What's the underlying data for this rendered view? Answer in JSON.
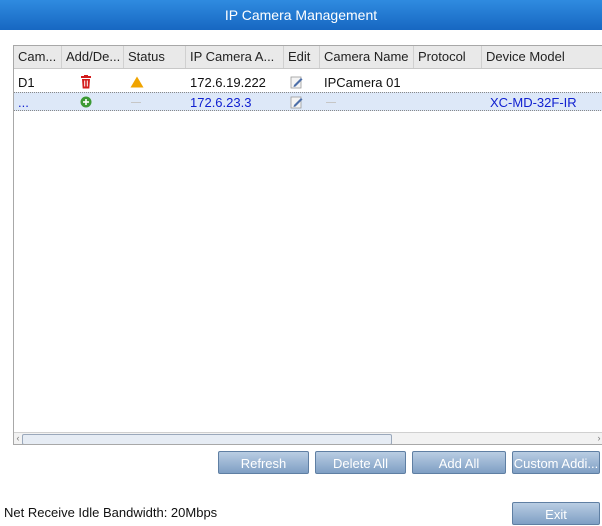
{
  "window": {
    "title": "IP Camera Management"
  },
  "table": {
    "headers": [
      "Cam...",
      "Add/De...",
      "Status",
      "IP Camera A...",
      "Edit",
      "Camera Name",
      "Protocol",
      "Device Model"
    ],
    "rows": [
      {
        "cam": "D1",
        "add_delete_icon": "delete-icon",
        "status_icon": "warning-icon",
        "ip": "172.6.19.222",
        "edit_icon": "edit-icon",
        "camera_name": "IPCamera 01",
        "protocol": "",
        "device_model": ""
      },
      {
        "cam": "...",
        "add_delete_icon": "add-icon",
        "status": "—",
        "ip": "172.6.23.3",
        "edit_icon": "edit-icon",
        "camera_name": "—",
        "protocol": "",
        "device_model": "XC-MD-32F-IR"
      }
    ]
  },
  "buttons": {
    "refresh": "Refresh",
    "delete_all": "Delete All",
    "add_all": "Add All",
    "custom_add": "Custom Addi...",
    "exit": "Exit"
  },
  "footer": {
    "bandwidth": "Net Receive Idle Bandwidth: 20Mbps"
  },
  "colors": {
    "title_bar": "#1f78d1",
    "selected_text": "#1020d0",
    "button": "#9ab4d3"
  }
}
